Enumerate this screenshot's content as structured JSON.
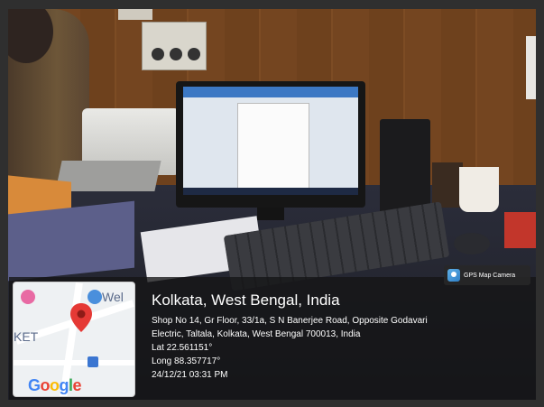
{
  "stamp": {
    "app_label": "GPS Map Camera",
    "location_title": "Kolkata, West Bengal, India",
    "address_line1": "Shop No 14, Gr Floor, 33/1a, S N Banerjee Road, Opposite Godavari",
    "address_line2": "Electric, Taltala, Kolkata, West Bengal 700013, India",
    "lat": "Lat 22.561151°",
    "long": "Long 88.357717°",
    "datetime": "24/12/21 03:31 PM"
  },
  "map": {
    "label_top_right": "Wel",
    "label_left": "KET",
    "google_letters": [
      "G",
      "o",
      "o",
      "g",
      "l",
      "e"
    ],
    "google_colors": [
      "#4285F4",
      "#EA4335",
      "#FBBC05",
      "#4285F4",
      "#34A853",
      "#EA4335"
    ],
    "pin_color": "#E53935"
  },
  "icons": {
    "app_icon": "gps-map-camera-icon",
    "map_pin": "map-pin-icon",
    "shopping_poi": "shopping-cart-poi-icon",
    "heart_poi": "heart-poi-icon",
    "building_poi": "building-poi-icon"
  }
}
